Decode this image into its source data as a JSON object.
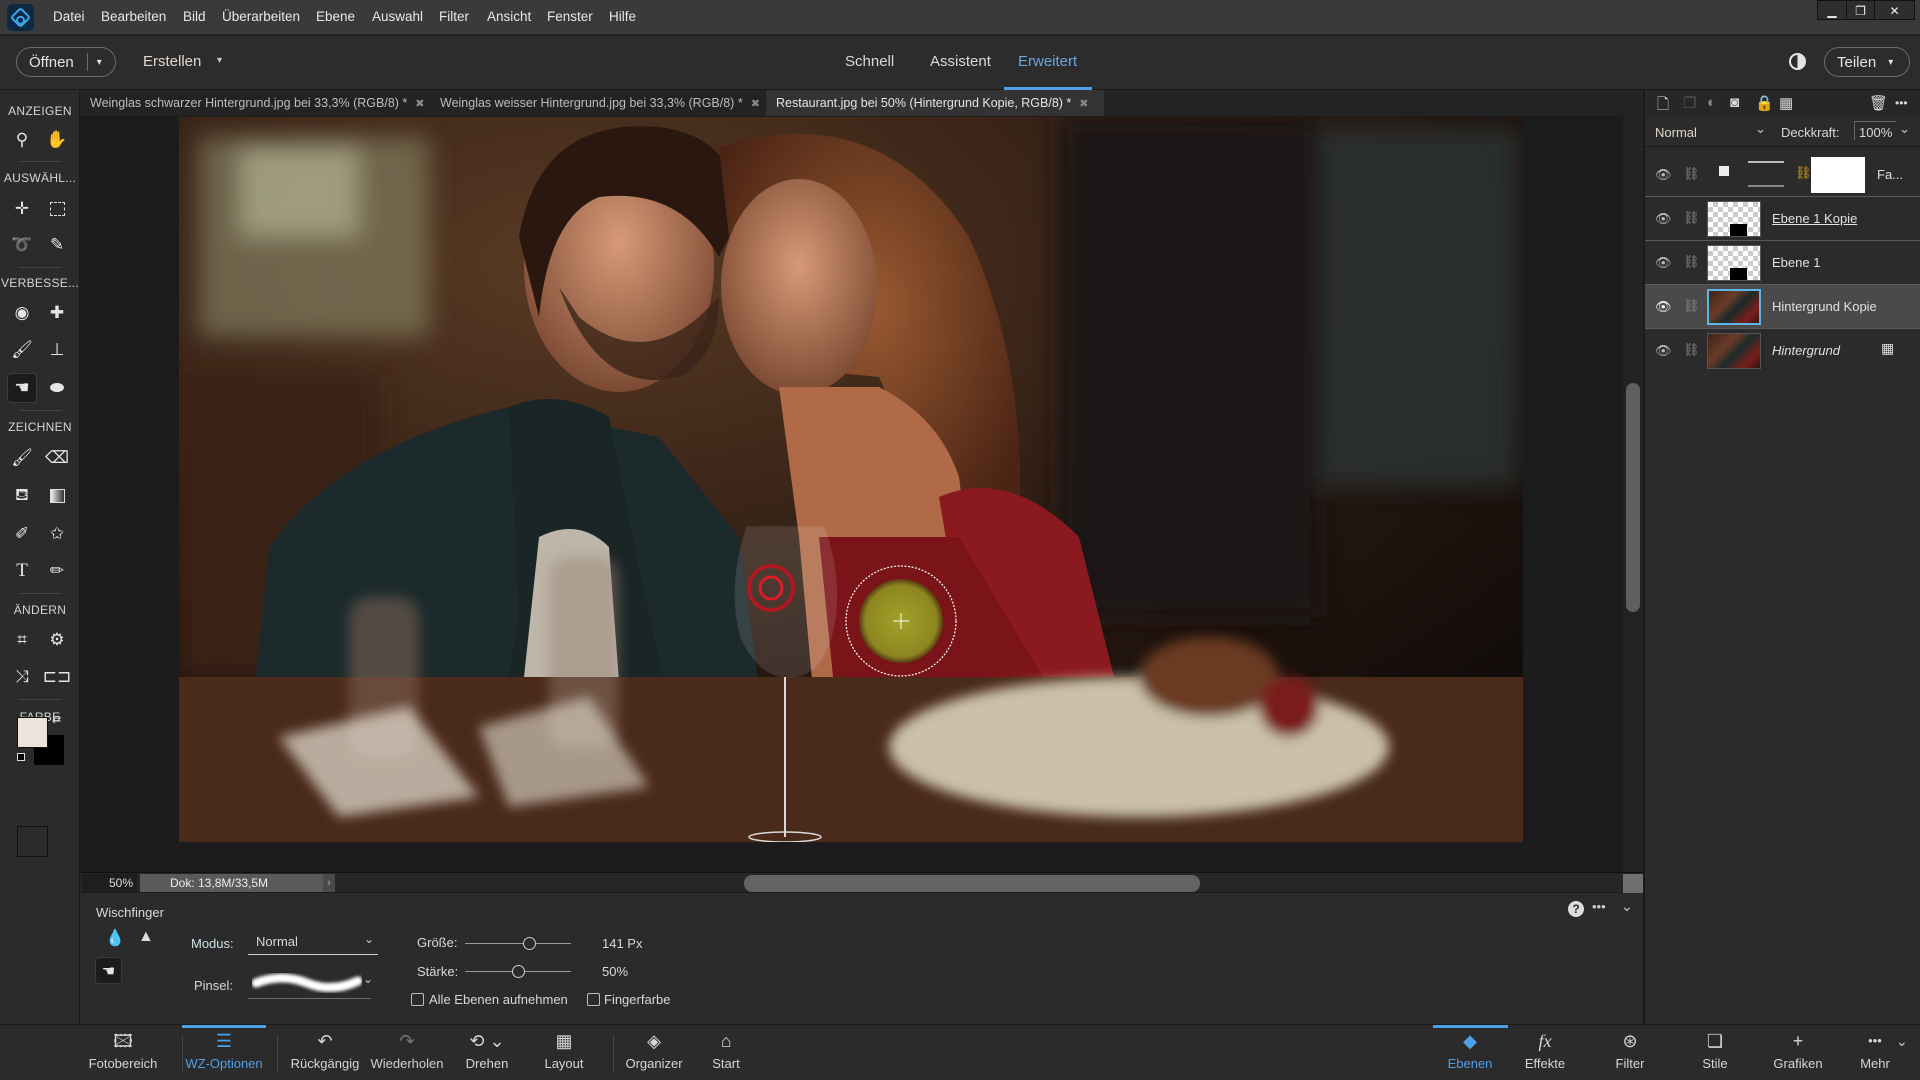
{
  "app": {
    "menu": [
      "Datei",
      "Bearbeiten",
      "Bild",
      "Überarbeiten",
      "Ebene",
      "Auswahl",
      "Filter",
      "Ansicht",
      "Fenster",
      "Hilfe"
    ],
    "window_controls": {
      "minimize": "▁",
      "restore": "❐",
      "close": "✕"
    }
  },
  "optionbar": {
    "open_label": "Öffnen",
    "create_label": "Erstellen",
    "modes": [
      "Schnell",
      "Assistent",
      "Erweitert"
    ],
    "active_mode": "Erweitert",
    "share_label": "Teilen"
  },
  "doc_tabs": [
    {
      "label": "Weinglas schwarzer Hintergrund.jpg bei 33,3% (RGB/8) *",
      "active": false
    },
    {
      "label": "Weinglas weisser Hintergrund.jpg bei 33,3% (RGB/8) *",
      "active": false
    },
    {
      "label": "Restaurant.jpg bei 50% (Hintergrund Kopie, RGB/8) *",
      "active": true
    }
  ],
  "toolbox": {
    "sections": {
      "view": "ANZEIGEN",
      "select": "AUSWÄHL...",
      "enhance": "VERBESSE...",
      "draw": "ZEICHNEN",
      "modify": "ÄNDERN",
      "color": "FARBE"
    },
    "foreground_color": "#ece3da",
    "background_color": "#000000"
  },
  "status": {
    "zoom": "50%",
    "doc_info": "Dok: 13,8M/33,5M"
  },
  "tool_options": {
    "tool_name": "Wischfinger",
    "mode_label": "Modus:",
    "mode_value": "Normal",
    "brush_label": "Pinsel:",
    "size_label": "Größe:",
    "size_value": "141 Px",
    "size_fraction": 0.6,
    "strength_label": "Stärke:",
    "strength_value": "50%",
    "strength_fraction": 0.5,
    "sample_all_layers": {
      "label": "Alle Ebenen aufnehmen",
      "checked": false
    },
    "finger_painting": {
      "label": "Fingerfarbe",
      "checked": false
    }
  },
  "layers": {
    "blend_mode": "Normal",
    "opacity_label": "Deckkraft:",
    "opacity_value": "100%",
    "items": [
      {
        "name": "Fa...",
        "type": "adjustment",
        "selected": false,
        "italic": false
      },
      {
        "name": "Ebene 1 Kopie",
        "type": "transparent",
        "selected": false,
        "italic": false,
        "underlined": true
      },
      {
        "name": "Ebene 1",
        "type": "transparent",
        "selected": false,
        "italic": false
      },
      {
        "name": "Hintergrund Kopie",
        "type": "photo",
        "selected": true,
        "italic": false
      },
      {
        "name": "Hintergrund",
        "type": "photo",
        "selected": false,
        "italic": true,
        "locked": true
      }
    ]
  },
  "taskbar": {
    "left": [
      {
        "label": "Fotobereich",
        "icon": "🖾"
      },
      {
        "label": "WZ-Optionen",
        "icon": "☰",
        "active": true
      },
      {
        "label": "Rückgängig",
        "icon": "↶"
      },
      {
        "label": "Wiederholen",
        "icon": "↷"
      },
      {
        "label": "Drehen",
        "icon": "⟲ ⌄"
      },
      {
        "label": "Layout",
        "icon": "▦"
      },
      {
        "label": "Organizer",
        "icon": "◈"
      },
      {
        "label": "Start",
        "icon": "⌂"
      }
    ],
    "right": [
      {
        "label": "Ebenen",
        "icon": "◆",
        "active": true
      },
      {
        "label": "Effekte",
        "icon": "fx"
      },
      {
        "label": "Filter",
        "icon": "⊛"
      },
      {
        "label": "Stile",
        "icon": "❏"
      },
      {
        "label": "Grafiken",
        "icon": "+"
      },
      {
        "label": "Mehr",
        "icon": "•••"
      }
    ]
  },
  "colors": {
    "accent": "#4f9fe6",
    "panel": "#2b2b2b",
    "menubar": "#3a3a3b"
  }
}
